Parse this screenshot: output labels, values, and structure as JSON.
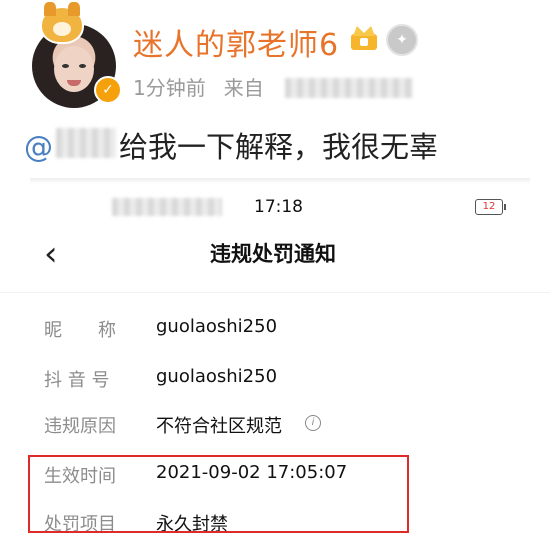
{
  "post": {
    "username": "迷人的郭老师6",
    "time_ago": "1分钟前",
    "source_prefix": "来自",
    "mention_at": "@",
    "message": "给我一下解释，我很无辜"
  },
  "phone": {
    "status_time": "17:18",
    "battery_level": "12",
    "title": "违规处罚通知",
    "rows": [
      {
        "label": "昵　　称",
        "value": "guolaoshi250"
      },
      {
        "label": "抖 音 号",
        "value": "guolaoshi250"
      },
      {
        "label": "违规原因",
        "value": "不符合社区规范"
      },
      {
        "label": "生效时间",
        "value": "2021-09-02 17:05:07"
      },
      {
        "label": "处罚项目",
        "value": "永久封禁"
      }
    ]
  },
  "icons": {
    "crown": "crown-icon",
    "medal": "medal-icon",
    "verified": "verified-badge-icon",
    "back": "chevron-left-icon",
    "info": "info-icon",
    "battery": "battery-icon"
  },
  "colors": {
    "username": "#e8742b",
    "mention": "#4a7fc1",
    "highlight": "#e02a2a",
    "verified": "#f4a10b"
  }
}
